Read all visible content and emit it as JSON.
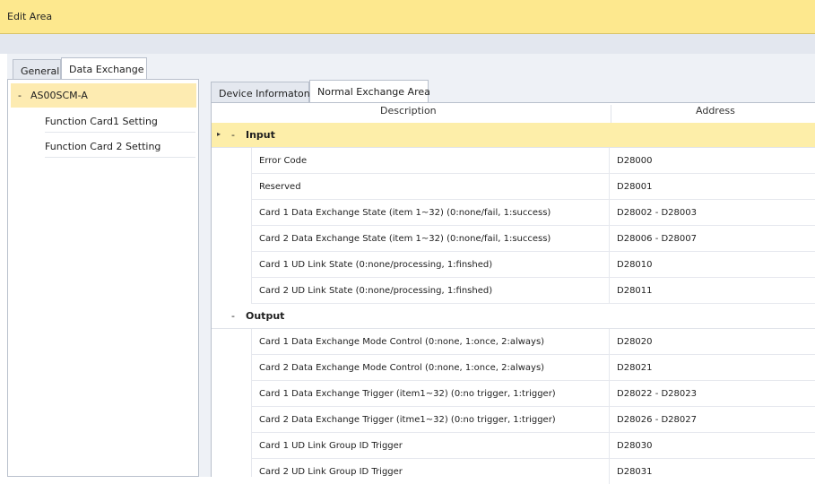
{
  "window": {
    "title": "Edit Area"
  },
  "outer_tabs": [
    {
      "label": "General"
    },
    {
      "label": "Data Exchange"
    }
  ],
  "tree": {
    "root": "AS00SCM-A",
    "children": [
      {
        "label": "Function Card1 Setting"
      },
      {
        "label": "Function Card 2 Setting"
      }
    ]
  },
  "inner_tabs": [
    {
      "label": "Device Informaton"
    },
    {
      "label": "Normal Exchange Area"
    }
  ],
  "table": {
    "headers": {
      "description": "Description",
      "address": "Address"
    },
    "input_group": {
      "label": "Input",
      "rows": [
        {
          "description": "Error Code",
          "address": "D28000"
        },
        {
          "description": "Reserved",
          "address": "D28001"
        },
        {
          "description": "Card 1 Data Exchange State (item 1~32) (0:none/fail, 1:success)",
          "address": "D28002 - D28003"
        },
        {
          "description": "Card 2 Data Exchange State (item 1~32) (0:none/fail, 1:success)",
          "address": "D28006 - D28007"
        },
        {
          "description": "Card 1 UD Link State (0:none/processing, 1:finshed)",
          "address": "D28010"
        },
        {
          "description": "Card 2 UD Link State (0:none/processing, 1:finshed)",
          "address": "D28011"
        }
      ]
    },
    "output_group": {
      "label": "Output",
      "rows": [
        {
          "description": "Card 1 Data Exchange Mode Control (0:none, 1:once, 2:always)",
          "address": "D28020"
        },
        {
          "description": "Card 2 Data Exchange Mode Control (0:none, 1:once, 2:always)",
          "address": "D28021"
        },
        {
          "description": "Card 1 Data Exchange Trigger (item1~32) (0:no trigger, 1:trigger)",
          "address": "D28022 - D28023"
        },
        {
          "description": "Card 2 Data Exchange Trigger (itme1~32) (0:no trigger, 1:trigger)",
          "address": "D28026 - D28027"
        },
        {
          "description": "Card 1 UD Link Group ID Trigger",
          "address": "D28030"
        },
        {
          "description": "Card 2 UD Link Group ID Trigger",
          "address": "D28031"
        }
      ]
    }
  },
  "colors": {
    "title_bar": "#fde88e",
    "selected_tree": "#fdebb1",
    "input_group": "#fdeea9"
  }
}
